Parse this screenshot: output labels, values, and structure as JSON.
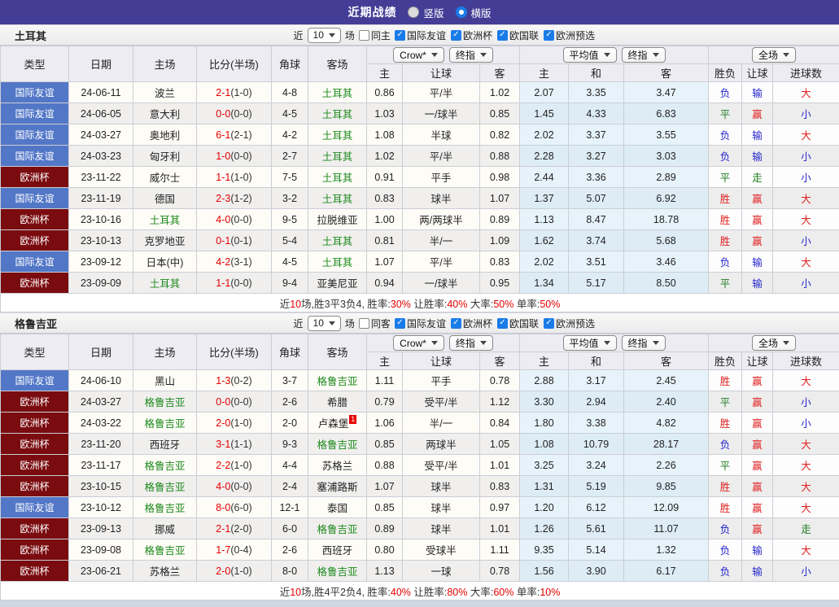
{
  "title_bar": {
    "title": "近期战绩",
    "radios": [
      {
        "label": "竖版",
        "selected": false
      },
      {
        "label": "横版",
        "selected": true
      }
    ]
  },
  "colors": {
    "topbar_bg": "#433d96",
    "accent_blue": "#1a7ce8",
    "type_friendly_bg": "#5377c7",
    "type_eurocup_bg": "#7a0c10",
    "focus_team_green": "#1e8a1e",
    "score_red": "#e60000",
    "result_red": "#e02020",
    "result_green": "#1e7d1e",
    "result_blue": "#2525cf",
    "avg_column_bg": "#e7f3fa",
    "row_even_bg": "#f0efee"
  },
  "result_color_map": {
    "胜": "red",
    "赢": "red",
    "大": "red",
    "平": "green",
    "走": "green",
    "负": "blue",
    "输": "blue",
    "小": "blue"
  },
  "type_style_map": {
    "国际友谊": "t-friendly",
    "欧洲杯": "t-euro"
  },
  "table_header": {
    "left_cols": [
      "类型",
      "日期",
      "主场",
      "比分(半场)",
      "角球",
      "客场"
    ],
    "groups": [
      {
        "dropdowns": [
          "Crow*",
          "终指"
        ],
        "cols": [
          "主",
          "让球",
          "客"
        ]
      },
      {
        "dropdowns": [
          "平均值",
          "终指"
        ],
        "cols": [
          "主",
          "和",
          "客"
        ]
      },
      {
        "dropdowns": [
          "全场"
        ],
        "cols": [
          "胜负",
          "让球",
          "进球数"
        ]
      }
    ]
  },
  "sections": [
    {
      "team": "土耳其",
      "filter": {
        "near_label": "近",
        "count": "10",
        "games_label": "场",
        "same_label": "同主",
        "same_checked": false,
        "leagues": [
          "国际友谊",
          "欧洲杯",
          "欧国联",
          "欧洲预选"
        ],
        "leagues_checked": [
          true,
          true,
          true,
          true
        ]
      },
      "rows": [
        {
          "type": "国际友谊",
          "date": "24-06-11",
          "home": "波兰",
          "home_focus": false,
          "score": "2-1",
          "half": "(1-0)",
          "corners": "4-8",
          "away": "土耳其",
          "away_focus": true,
          "odds": [
            "0.86",
            "平/半",
            "1.02"
          ],
          "avg": [
            "2.07",
            "3.35",
            "3.47"
          ],
          "results": [
            "负",
            "输",
            "大"
          ]
        },
        {
          "type": "国际友谊",
          "date": "24-06-05",
          "home": "意大利",
          "home_focus": false,
          "score": "0-0",
          "half": "(0-0)",
          "corners": "4-5",
          "away": "土耳其",
          "away_focus": true,
          "odds": [
            "1.03",
            "一/球半",
            "0.85"
          ],
          "avg": [
            "1.45",
            "4.33",
            "6.83"
          ],
          "results": [
            "平",
            "赢",
            "小"
          ]
        },
        {
          "type": "国际友谊",
          "date": "24-03-27",
          "home": "奥地利",
          "home_focus": false,
          "score": "6-1",
          "half": "(2-1)",
          "corners": "4-2",
          "away": "土耳其",
          "away_focus": true,
          "odds": [
            "1.08",
            "半球",
            "0.82"
          ],
          "avg": [
            "2.02",
            "3.37",
            "3.55"
          ],
          "results": [
            "负",
            "输",
            "大"
          ]
        },
        {
          "type": "国际友谊",
          "date": "24-03-23",
          "home": "匈牙利",
          "home_focus": false,
          "score": "1-0",
          "half": "(0-0)",
          "corners": "2-7",
          "away": "土耳其",
          "away_focus": true,
          "odds": [
            "1.02",
            "平/半",
            "0.88"
          ],
          "avg": [
            "2.28",
            "3.27",
            "3.03"
          ],
          "results": [
            "负",
            "输",
            "小"
          ]
        },
        {
          "type": "欧洲杯",
          "date": "23-11-22",
          "home": "威尔士",
          "home_focus": false,
          "score": "1-1",
          "half": "(1-0)",
          "corners": "7-5",
          "away": "土耳其",
          "away_focus": true,
          "odds": [
            "0.91",
            "平手",
            "0.98"
          ],
          "avg": [
            "2.44",
            "3.36",
            "2.89"
          ],
          "results": [
            "平",
            "走",
            "小"
          ]
        },
        {
          "type": "国际友谊",
          "date": "23-11-19",
          "home": "德国",
          "home_focus": false,
          "score": "2-3",
          "half": "(1-2)",
          "corners": "3-2",
          "away": "土耳其",
          "away_focus": true,
          "odds": [
            "0.83",
            "球半",
            "1.07"
          ],
          "avg": [
            "1.37",
            "5.07",
            "6.92"
          ],
          "results": [
            "胜",
            "赢",
            "大"
          ]
        },
        {
          "type": "欧洲杯",
          "date": "23-10-16",
          "home": "土耳其",
          "home_focus": true,
          "score": "4-0",
          "half": "(0-0)",
          "corners": "9-5",
          "away": "拉脱维亚",
          "away_focus": false,
          "odds": [
            "1.00",
            "两/两球半",
            "0.89"
          ],
          "avg": [
            "1.13",
            "8.47",
            "18.78"
          ],
          "results": [
            "胜",
            "赢",
            "大"
          ]
        },
        {
          "type": "欧洲杯",
          "date": "23-10-13",
          "home": "克罗地亚",
          "home_focus": false,
          "score": "0-1",
          "half": "(0-1)",
          "corners": "5-4",
          "away": "土耳其",
          "away_focus": true,
          "odds": [
            "0.81",
            "半/一",
            "1.09"
          ],
          "avg": [
            "1.62",
            "3.74",
            "5.68"
          ],
          "results": [
            "胜",
            "赢",
            "小"
          ]
        },
        {
          "type": "国际友谊",
          "date": "23-09-12",
          "home": "日本(中)",
          "home_focus": false,
          "score": "4-2",
          "half": "(3-1)",
          "corners": "4-5",
          "away": "土耳其",
          "away_focus": true,
          "odds": [
            "1.07",
            "平/半",
            "0.83"
          ],
          "avg": [
            "2.02",
            "3.51",
            "3.46"
          ],
          "results": [
            "负",
            "输",
            "大"
          ]
        },
        {
          "type": "欧洲杯",
          "date": "23-09-09",
          "home": "土耳其",
          "home_focus": true,
          "score": "1-1",
          "half": "(0-0)",
          "corners": "9-4",
          "away": "亚美尼亚",
          "away_focus": false,
          "odds": [
            "0.94",
            "一/球半",
            "0.95"
          ],
          "avg": [
            "1.34",
            "5.17",
            "8.50"
          ],
          "results": [
            "平",
            "输",
            "小"
          ]
        }
      ],
      "summary": [
        [
          "近",
          0
        ],
        [
          "10",
          1
        ],
        [
          "场,胜3平3负4, 胜率:",
          0
        ],
        [
          "30%",
          1
        ],
        [
          " 让胜率:",
          0
        ],
        [
          "40%",
          1
        ],
        [
          " 大率:",
          0
        ],
        [
          "50%",
          1
        ],
        [
          " 单率:",
          0
        ],
        [
          "50%",
          1
        ]
      ]
    },
    {
      "team": "格鲁吉亚",
      "filter": {
        "near_label": "近",
        "count": "10",
        "games_label": "场",
        "same_label": "同客",
        "same_checked": false,
        "leagues": [
          "国际友谊",
          "欧洲杯",
          "欧国联",
          "欧洲预选"
        ],
        "leagues_checked": [
          true,
          true,
          true,
          true
        ]
      },
      "rows": [
        {
          "type": "国际友谊",
          "date": "24-06-10",
          "home": "黑山",
          "home_focus": false,
          "score": "1-3",
          "half": "(0-2)",
          "corners": "3-7",
          "away": "格鲁吉亚",
          "away_focus": true,
          "odds": [
            "1.11",
            "平手",
            "0.78"
          ],
          "avg": [
            "2.88",
            "3.17",
            "2.45"
          ],
          "results": [
            "胜",
            "赢",
            "大"
          ]
        },
        {
          "type": "欧洲杯",
          "date": "24-03-27",
          "home": "格鲁吉亚",
          "home_focus": true,
          "score": "0-0",
          "half": "(0-0)",
          "corners": "2-6",
          "away": "希腊",
          "away_focus": false,
          "odds": [
            "0.79",
            "受平/半",
            "1.12"
          ],
          "avg": [
            "3.30",
            "2.94",
            "2.40"
          ],
          "results": [
            "平",
            "赢",
            "小"
          ]
        },
        {
          "type": "欧洲杯",
          "date": "24-03-22",
          "home": "格鲁吉亚",
          "home_focus": true,
          "score": "2-0",
          "half": "(1-0)",
          "corners": "2-0",
          "away": "卢森堡",
          "away_focus": false,
          "away_card": "1",
          "odds": [
            "1.06",
            "半/一",
            "0.84"
          ],
          "avg": [
            "1.80",
            "3.38",
            "4.82"
          ],
          "results": [
            "胜",
            "赢",
            "小"
          ]
        },
        {
          "type": "欧洲杯",
          "date": "23-11-20",
          "home": "西班牙",
          "home_focus": false,
          "score": "3-1",
          "half": "(1-1)",
          "corners": "9-3",
          "away": "格鲁吉亚",
          "away_focus": true,
          "odds": [
            "0.85",
            "两球半",
            "1.05"
          ],
          "avg": [
            "1.08",
            "10.79",
            "28.17"
          ],
          "results": [
            "负",
            "赢",
            "大"
          ]
        },
        {
          "type": "欧洲杯",
          "date": "23-11-17",
          "home": "格鲁吉亚",
          "home_focus": true,
          "score": "2-2",
          "half": "(1-0)",
          "corners": "4-4",
          "away": "苏格兰",
          "away_focus": false,
          "odds": [
            "0.88",
            "受平/半",
            "1.01"
          ],
          "avg": [
            "3.25",
            "3.24",
            "2.26"
          ],
          "results": [
            "平",
            "赢",
            "大"
          ]
        },
        {
          "type": "欧洲杯",
          "date": "23-10-15",
          "home": "格鲁吉亚",
          "home_focus": true,
          "score": "4-0",
          "half": "(0-0)",
          "corners": "2-4",
          "away": "塞浦路斯",
          "away_focus": false,
          "odds": [
            "1.07",
            "球半",
            "0.83"
          ],
          "avg": [
            "1.31",
            "5.19",
            "9.85"
          ],
          "results": [
            "胜",
            "赢",
            "大"
          ]
        },
        {
          "type": "国际友谊",
          "date": "23-10-12",
          "home": "格鲁吉亚",
          "home_focus": true,
          "score": "8-0",
          "half": "(6-0)",
          "corners": "12-1",
          "away": "泰国",
          "away_focus": false,
          "odds": [
            "0.85",
            "球半",
            "0.97"
          ],
          "avg": [
            "1.20",
            "6.12",
            "12.09"
          ],
          "results": [
            "胜",
            "赢",
            "大"
          ]
        },
        {
          "type": "欧洲杯",
          "date": "23-09-13",
          "home": "挪威",
          "home_focus": false,
          "score": "2-1",
          "half": "(2-0)",
          "corners": "6-0",
          "away": "格鲁吉亚",
          "away_focus": true,
          "odds": [
            "0.89",
            "球半",
            "1.01"
          ],
          "avg": [
            "1.26",
            "5.61",
            "11.07"
          ],
          "results": [
            "负",
            "赢",
            "走"
          ]
        },
        {
          "type": "欧洲杯",
          "date": "23-09-08",
          "home": "格鲁吉亚",
          "home_focus": true,
          "score": "1-7",
          "half": "(0-4)",
          "corners": "2-6",
          "away": "西班牙",
          "away_focus": false,
          "odds": [
            "0.80",
            "受球半",
            "1.11"
          ],
          "avg": [
            "9.35",
            "5.14",
            "1.32"
          ],
          "results": [
            "负",
            "输",
            "大"
          ]
        },
        {
          "type": "欧洲杯",
          "date": "23-06-21",
          "home": "苏格兰",
          "home_focus": false,
          "score": "2-0",
          "half": "(1-0)",
          "corners": "8-0",
          "away": "格鲁吉亚",
          "away_focus": true,
          "odds": [
            "1.13",
            "一球",
            "0.78"
          ],
          "avg": [
            "1.56",
            "3.90",
            "6.17"
          ],
          "results": [
            "负",
            "输",
            "小"
          ]
        }
      ],
      "summary": [
        [
          "近",
          0
        ],
        [
          "10",
          1
        ],
        [
          "场,胜4平2负4, 胜率:",
          0
        ],
        [
          "40%",
          1
        ],
        [
          " 让胜率:",
          0
        ],
        [
          "80%",
          1
        ],
        [
          " 大率:",
          0
        ],
        [
          "60%",
          1
        ],
        [
          " 单率:",
          0
        ],
        [
          "10%",
          1
        ]
      ]
    }
  ]
}
